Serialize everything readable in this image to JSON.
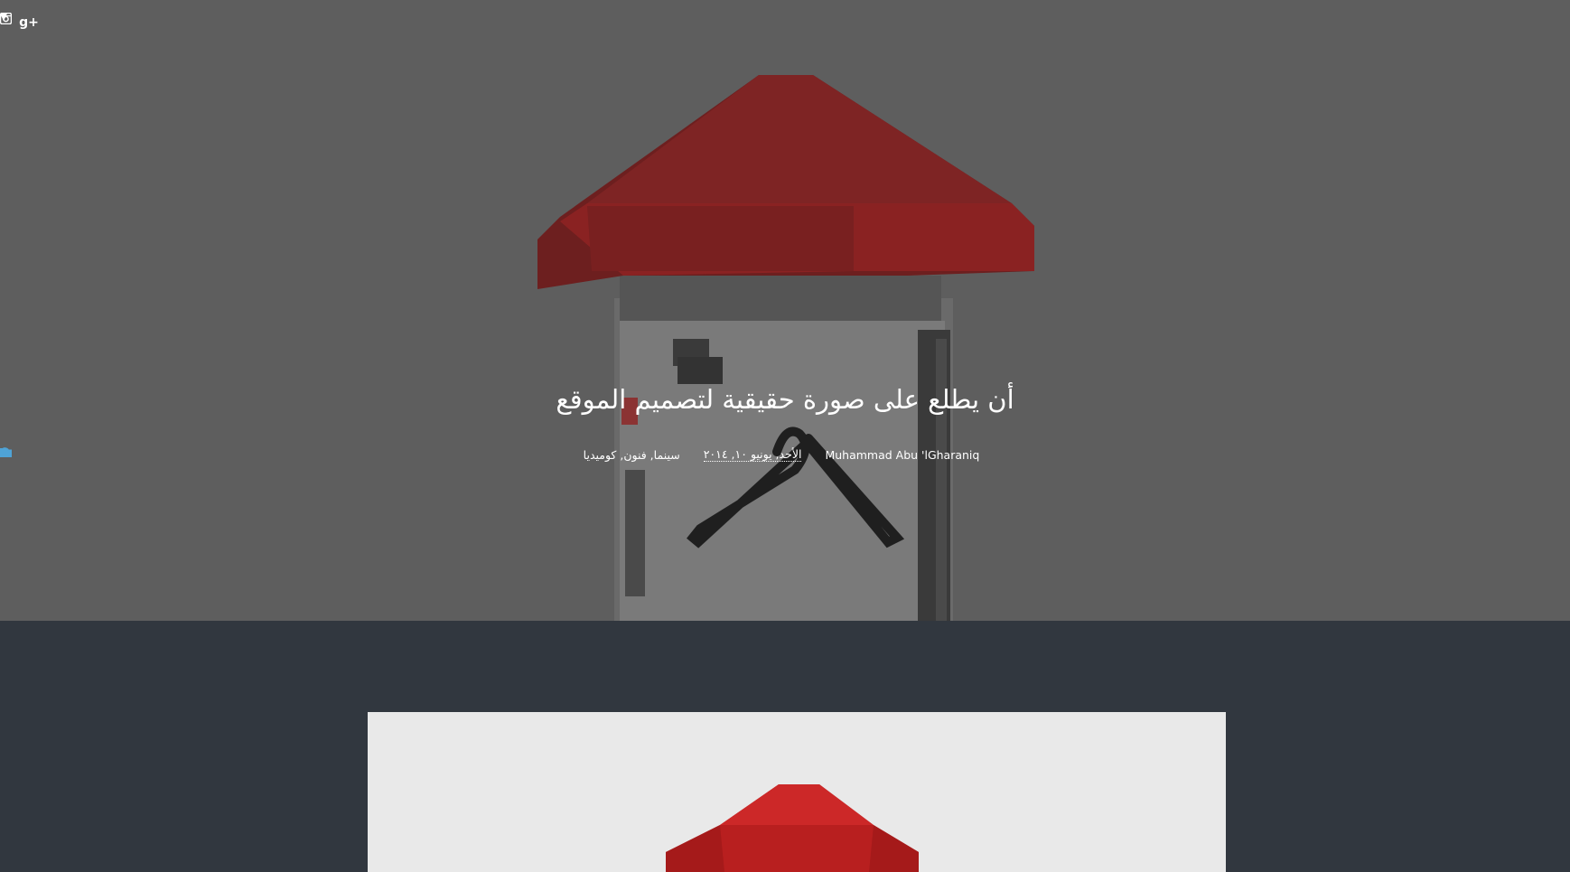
{
  "social": {
    "icons": [
      {
        "name": "twitter-icon",
        "glyph": "🐦"
      },
      {
        "name": "google-plus-icon",
        "glyph": "g+"
      },
      {
        "name": "instagram-icon",
        "glyph": "◙"
      }
    ]
  },
  "post": {
    "title": "أن يطلع على صورة حقيقية لتصميم الموقع",
    "author": "Muhammad Abu 'lGharaniq",
    "date": "الأحد, يونيو ١٠, ٢٠١٤",
    "categories": "سينما, فنون, كوميديا"
  },
  "colors": {
    "hero_bg": "#5e5e5e",
    "page_bg": "#31373f",
    "roof": "#8b1d1d",
    "accent_icon": "#4fa3d6"
  }
}
